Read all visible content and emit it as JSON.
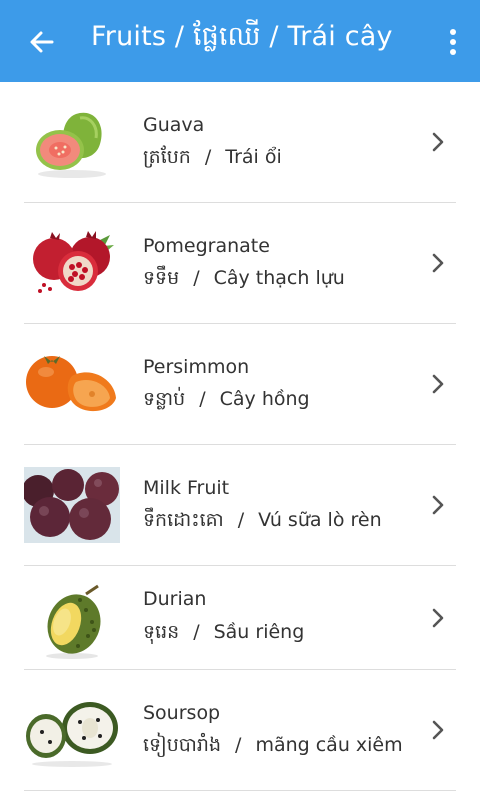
{
  "appbar": {
    "title": "Fruits / ផ្លែឈើ / Trái cây",
    "back_icon": "arrow-left-icon",
    "menu_icon": "more-vertical-icon",
    "color": "#3d9be9"
  },
  "items": [
    {
      "name": "Guava",
      "khmer": "ត្របែក",
      "separator": "/",
      "vietnamese": "Trái ổi"
    },
    {
      "name": "Pomegranate",
      "khmer": "ទទឹម",
      "separator": "/",
      "vietnamese": "Cây thạch lựu"
    },
    {
      "name": "Persimmon",
      "khmer": "ទន្លាប់",
      "separator": "/",
      "vietnamese": "Cây hồng"
    },
    {
      "name": "Milk Fruit",
      "khmer": "ទឹកដោះគោ",
      "separator": "/",
      "vietnamese": "Vú sữa lò rèn"
    },
    {
      "name": "Durian",
      "khmer": "ទុរេន",
      "separator": "/",
      "vietnamese": "Sầu riêng"
    },
    {
      "name": "Soursop",
      "khmer": "ទៀបបារាំង",
      "separator": "/",
      "vietnamese": "mãng cầu xiêm"
    }
  ]
}
